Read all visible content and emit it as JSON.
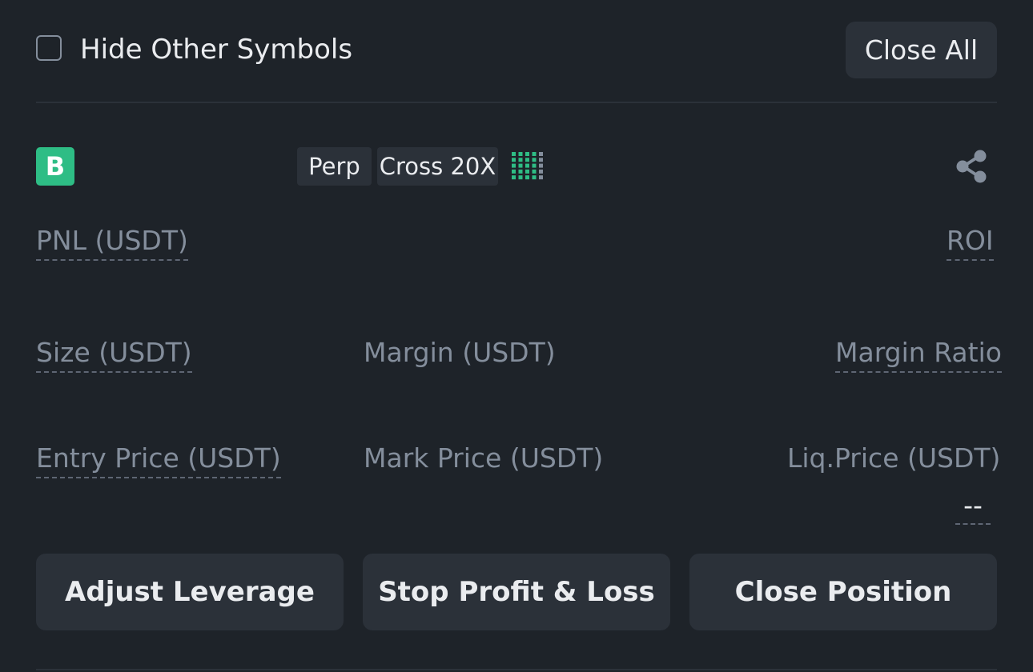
{
  "toolbar": {
    "hide_other_symbols": "Hide Other Symbols",
    "hide_other_symbols_checked": false,
    "close_all": "Close All"
  },
  "position": {
    "side_badge": "B",
    "tags": [
      "Perp",
      "Cross 20X"
    ],
    "adl_level": 4,
    "adl_max": 5,
    "share_icon": "share-icon",
    "fields": {
      "pnl_label": "PNL (USDT)",
      "roi_label": "ROI",
      "size_label": "Size (USDT)",
      "margin_label": "Margin (USDT)",
      "margin_ratio_label": "Margin Ratio",
      "entry_price_label": "Entry Price (USDT)",
      "mark_price_label": "Mark Price (USDT)",
      "liq_price_label": "Liq.Price (USDT)",
      "liq_price_value": "--"
    }
  },
  "actions": {
    "adjust_leverage": "Adjust Leverage",
    "stop_profit_loss": "Stop Profit & Loss",
    "close_position": "Close Position"
  },
  "colors": {
    "background": "#1e2329",
    "surface": "#2b3139",
    "buy_green": "#2ebd85",
    "text_primary": "#eaecef",
    "text_secondary": "#848e9c"
  }
}
